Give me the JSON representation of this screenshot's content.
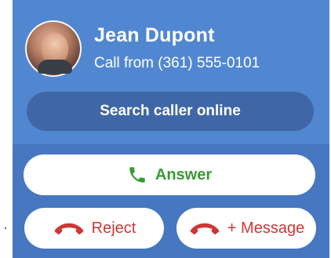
{
  "caller": {
    "name": "Jean Dupont",
    "call_from": "Call from (361) 555-0101"
  },
  "actions": {
    "search_label": "Search caller online",
    "answer_label": "Answer",
    "reject_label": "Reject",
    "message_label": "+ Message"
  },
  "icons": {
    "avatar": "caller-photo",
    "answer": "phone-icon",
    "reject": "hangup-phone-icon",
    "message": "hangup-phone-icon"
  },
  "colors": {
    "top_bg": "#5187d1",
    "bottom_bg": "#4677c0",
    "search_button": "#3f67a7",
    "answer": "#3a9a35",
    "reject": "#cf3636",
    "button_bg": "#ffffff"
  }
}
